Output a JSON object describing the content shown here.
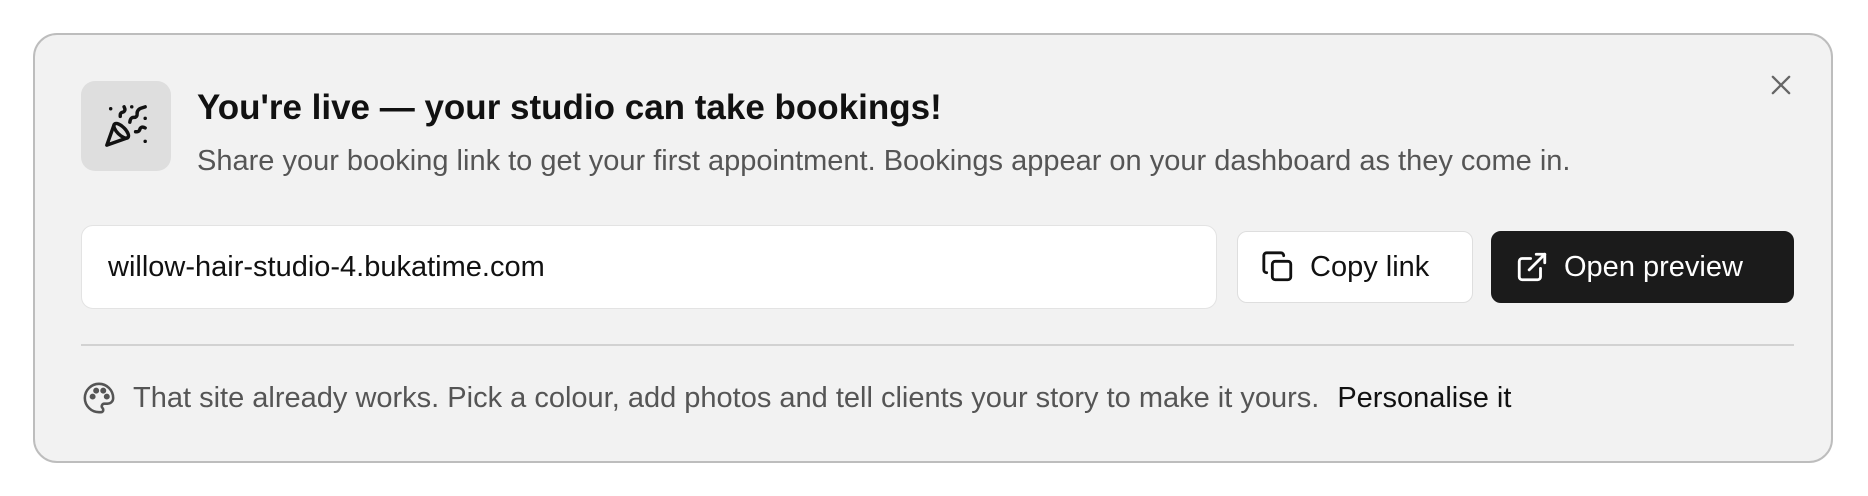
{
  "banner": {
    "icon": "party-popper-icon",
    "title": "You're live — your studio can take bookings!",
    "subtitle": "Share your booking link to get your first appointment. Bookings appear on your dashboard as they come in.",
    "close_icon": "close-icon"
  },
  "link": {
    "value": "willow-hair-studio-4.bukatime.com",
    "copy_label": "Copy link",
    "copy_icon": "copy-icon",
    "preview_label": "Open preview",
    "preview_icon": "external-link-icon"
  },
  "footer": {
    "icon": "palette-icon",
    "text": "That site already works. Pick a colour, add photos and tell clients your story to make it yours.",
    "link_label": "Personalise it"
  },
  "colors": {
    "card_background": "#f2f2f2",
    "primary_button": "#1b1b1b",
    "muted_text": "#555555"
  }
}
